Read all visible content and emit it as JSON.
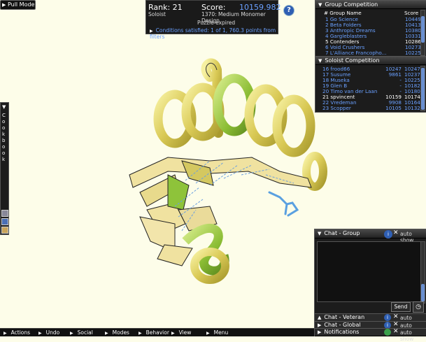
{
  "top": {
    "pull_mode": "Pull Mode"
  },
  "score": {
    "rank_label": "Rank: 21",
    "score_label": "Score:",
    "score_value": "10159.982",
    "mode": "Soloist",
    "puzzle": "1370: Medium Monomer Design",
    "status": "Puzzle expired",
    "conditions": "Conditions satisfied: 1 of 1, 760.3 points from filters"
  },
  "help": {
    "label": "?"
  },
  "group_competition": {
    "title": "Group Competition",
    "col_name": "# Group Name",
    "col_score": "Score",
    "rows": [
      {
        "text": "1 Go Science",
        "score": "10449",
        "style": "lnk"
      },
      {
        "text": "2 Beta Folders",
        "score": "10413",
        "style": "lnk"
      },
      {
        "text": "3 Anthropic Dreams",
        "score": "10380",
        "style": "lnk"
      },
      {
        "text": "4 Gargleblasters",
        "score": "10331",
        "style": "lnk"
      },
      {
        "text": "5 Contenders",
        "score": "10286",
        "style": "wht"
      },
      {
        "text": "6 Void Crushers",
        "score": "10273",
        "style": "lnk"
      },
      {
        "text": "7 L'Alliance Francopho...",
        "score": "10225",
        "style": "lnk"
      }
    ]
  },
  "soloist_competition": {
    "title": "Soloist Competition",
    "rows": [
      {
        "name": "16 frood66",
        "best": "10247",
        "score": "10247",
        "style": "lnk"
      },
      {
        "name": "17 Susume",
        "best": "9861",
        "score": "10237",
        "style": "lnk"
      },
      {
        "name": "18 Museka",
        "best": "-",
        "score": "10225",
        "style": "lnk"
      },
      {
        "name": "19 Glen B",
        "best": "-",
        "score": "10182",
        "style": "lnk"
      },
      {
        "name": "20 Timo van der Laan",
        "best": "-",
        "score": "10180",
        "style": "lnk"
      },
      {
        "name": "21 spvincent",
        "best": "10159",
        "score": "10174",
        "style": "wht"
      },
      {
        "name": "22 Vredeman",
        "best": "9908",
        "score": "10164",
        "style": "lnk"
      },
      {
        "name": "23 Scopper",
        "best": "10105",
        "score": "10132",
        "style": "lnk"
      }
    ]
  },
  "cookbook": {
    "title": "Cookbook"
  },
  "chat": {
    "group_title": "Chat - Group",
    "auto_show": "auto show",
    "send": "Send",
    "veteran_title": "Chat - Veteran",
    "global_title": "Chat - Global",
    "notifications_title": "Notifications"
  },
  "bottom_menu": [
    "Actions",
    "Undo",
    "Social",
    "Modes",
    "Behavior",
    "View",
    "Menu"
  ],
  "colors": {
    "accent": "#6aa0ff",
    "helix": "#d8cc5a",
    "sheet": "#f0e2a0",
    "highlight": "#8ec33a"
  }
}
